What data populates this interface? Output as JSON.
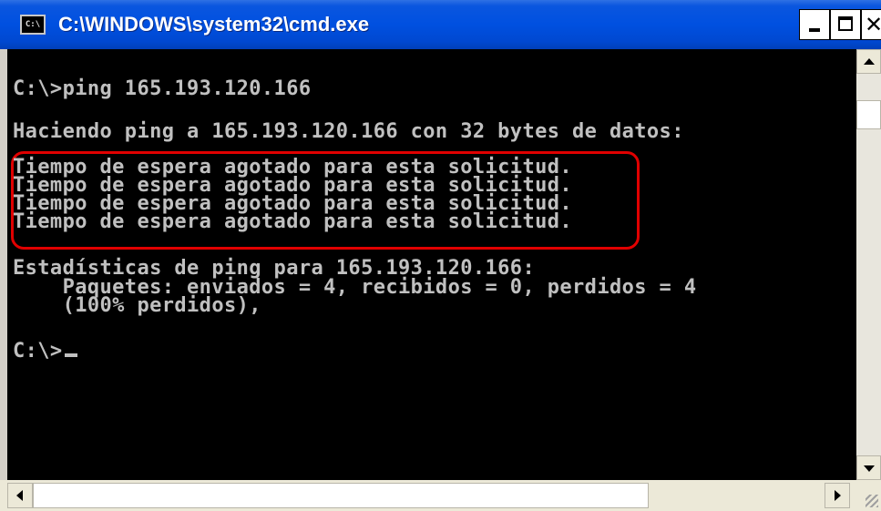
{
  "window": {
    "title": "C:\\WINDOWS\\system32\\cmd.exe",
    "icon": "cmd-console-icon",
    "icon_text": "C:\\"
  },
  "title_buttons": {
    "minimize_icon": "minimize-icon",
    "maximize_icon": "maximize-icon",
    "close_label": "✕"
  },
  "console": {
    "lines": [
      "C:\\>ping 165.193.120.166",
      "Haciendo ping a 165.193.120.166 con 32 bytes de datos:",
      "Tiempo de espera agotado para esta solicitud.",
      "Tiempo de espera agotado para esta solicitud.",
      "Tiempo de espera agotado para esta solicitud.",
      "Tiempo de espera agotado para esta solicitud.",
      "Estadísticas de ping para 165.193.120.166:",
      "    Paquetes: enviados = 4, recibidos = 0, perdidos = 4",
      "    (100% perdidos),",
      "C:\\>"
    ],
    "text_color": "#c0c0c0",
    "background": "#000000",
    "highlight_color": "#e00000"
  },
  "scrollbars": {
    "vertical_up_icon": "scroll-up-arrow-icon",
    "vertical_down_icon": "scroll-down-arrow-icon",
    "horizontal_left_icon": "scroll-left-arrow-icon",
    "horizontal_right_icon": "scroll-right-arrow-icon"
  }
}
